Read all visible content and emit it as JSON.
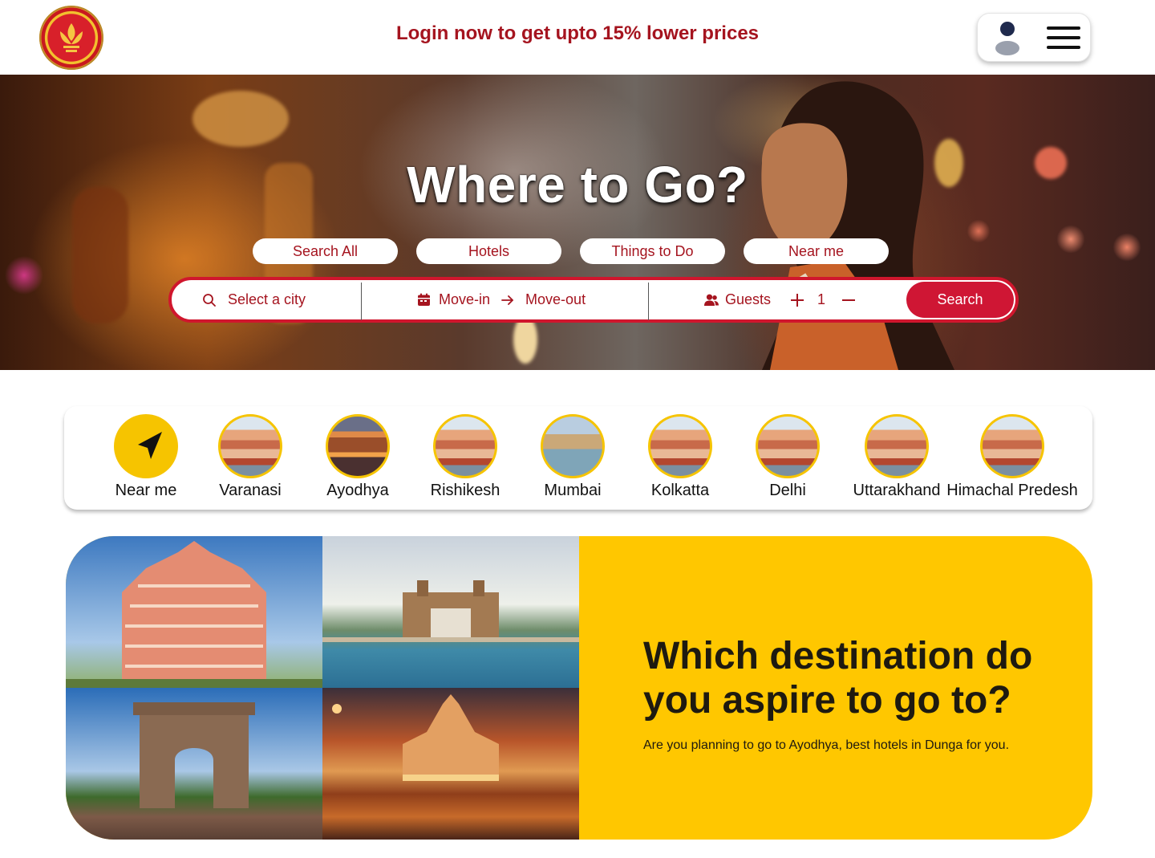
{
  "header": {
    "promo_text": "Login now to get upto 15% lower prices",
    "logo_icon": "lotus-emblem-icon",
    "user_icon": "user-icon",
    "menu_icon": "hamburger-menu-icon"
  },
  "hero": {
    "title": "Where to Go?",
    "tabs": [
      {
        "label": "Search All"
      },
      {
        "label": "Hotels"
      },
      {
        "label": "Things to Do"
      },
      {
        "label": "Near me"
      }
    ],
    "search": {
      "city_placeholder": "Select a city",
      "move_in": "Move-in",
      "move_out": "Move-out",
      "guests_label": "Guests",
      "guests_value": "1",
      "button_label": "Search"
    }
  },
  "cities": [
    {
      "label": "Near me",
      "icon": "navigation-arrow-icon"
    },
    {
      "label": "Varanasi"
    },
    {
      "label": "Ayodhya"
    },
    {
      "label": "Rishikesh"
    },
    {
      "label": "Mumbai"
    },
    {
      "label": "Kolkatta"
    },
    {
      "label": "Delhi"
    },
    {
      "label": "Uttarakhand"
    },
    {
      "label": "Himachal Predesh"
    }
  ],
  "destination": {
    "title": "Which destination do you aspire to go to?",
    "subtitle": "Are you planning to go to Ayodhya, best hotels in Dunga for you."
  },
  "colors": {
    "brand_red": "#a5141f",
    "button_red": "#cf1634",
    "accent_yellow": "#ffc700"
  }
}
